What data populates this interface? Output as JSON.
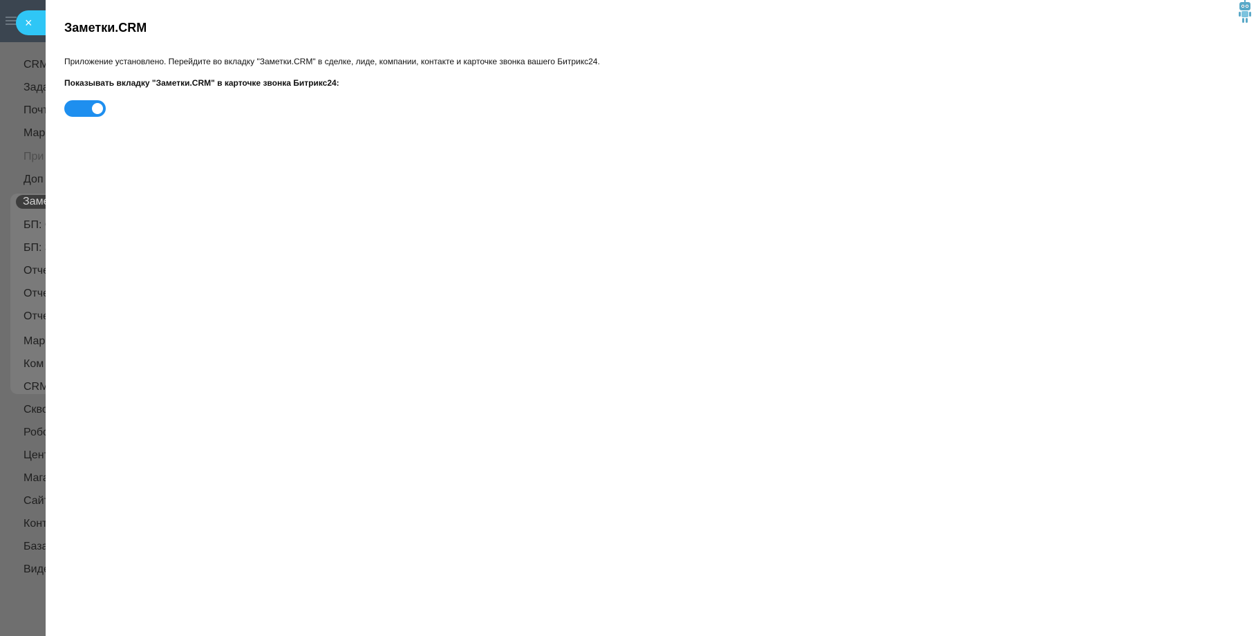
{
  "panel": {
    "title": "Заметки.CRM",
    "description": "Приложение установлено. Перейдите во вкладку \"Заметки.CRM\" в сделке, лиде, компании, контакте и карточке звонка вашего Битрикс24.",
    "toggle_label": "Показывать вкладку \"Заметки.CRM\" в карточке звонка Битрикс24:",
    "toggle_state": true
  },
  "close_button": {
    "icon": "close-icon",
    "glyph": "×"
  },
  "assistant": {
    "icon": "robot-icon"
  },
  "background_menu": {
    "items": [
      {
        "label": "CRM"
      },
      {
        "label": "Зада"
      },
      {
        "label": "Почт"
      },
      {
        "label": "Мар"
      },
      {
        "label": "При"
      },
      {
        "label": "Доп"
      },
      {
        "label": "Заме"
      },
      {
        "label": "БП: С"
      },
      {
        "label": "БП: З"
      },
      {
        "label": "Отче"
      },
      {
        "label": "Отче"
      },
      {
        "label": "Отче"
      },
      {
        "label": "Мар"
      },
      {
        "label": "Ком"
      },
      {
        "label": "CRM"
      },
      {
        "label": "Скво"
      },
      {
        "label": "Робо"
      },
      {
        "label": "Цент"
      },
      {
        "label": "Мага"
      },
      {
        "label": "Сайт"
      },
      {
        "label": "Конт"
      },
      {
        "label": "База"
      },
      {
        "label": "Виде"
      }
    ]
  },
  "colors": {
    "accent": "#2fc6f6",
    "toggle_on": "#1e8fef",
    "overlay": "#6f6f6f"
  }
}
